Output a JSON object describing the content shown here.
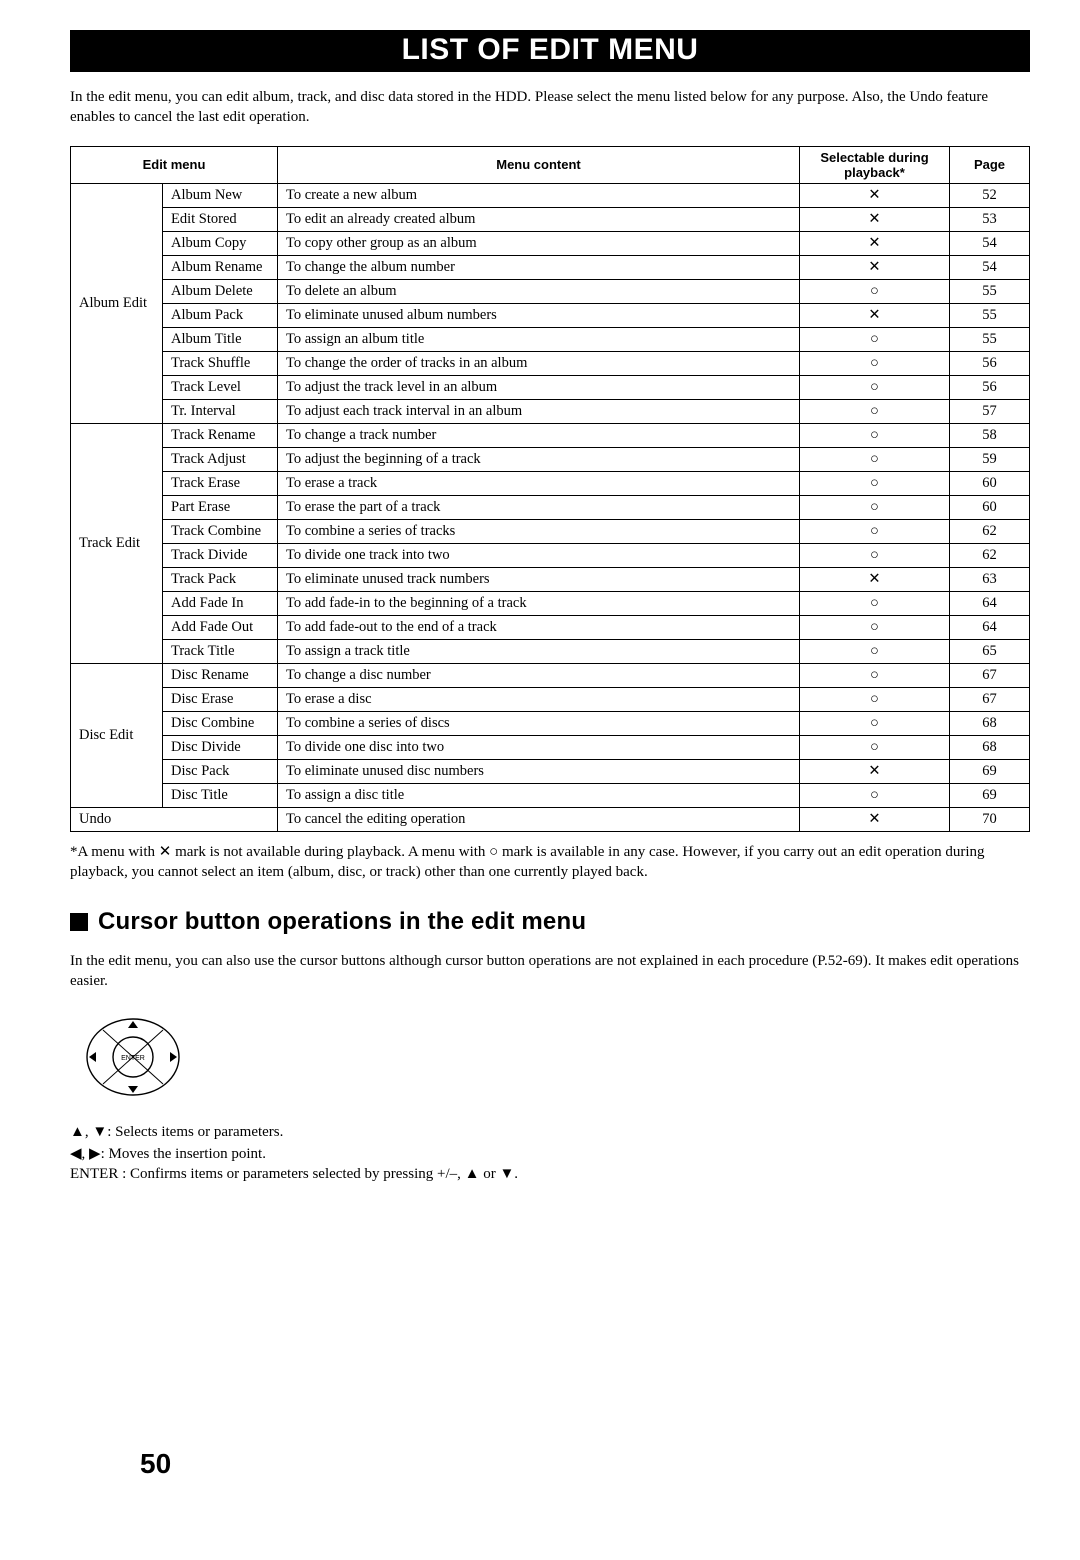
{
  "title": "LIST OF EDIT MENU",
  "intro": "In the edit menu, you can edit album, track, and disc data stored in the HDD. Please select the menu listed below for any purpose. Also, the Undo feature enables to cancel the last edit operation.",
  "headers": {
    "editMenu": "Edit menu",
    "menuContent": "Menu content",
    "selectable": "Selectable during playback*",
    "page": "Page"
  },
  "marks": {
    "x": "✕",
    "o": "○"
  },
  "groups": [
    {
      "name": "Album Edit",
      "rows": [
        {
          "sub": "Album New",
          "content": "To create a new album",
          "sel": "x",
          "page": "52"
        },
        {
          "sub": "Edit Stored",
          "content": "To edit an already created album",
          "sel": "x",
          "page": "53"
        },
        {
          "sub": "Album Copy",
          "content": "To copy other group as an album",
          "sel": "x",
          "page": "54"
        },
        {
          "sub": "Album Rename",
          "content": "To change the album number",
          "sel": "x",
          "page": "54"
        },
        {
          "sub": "Album Delete",
          "content": "To delete an album",
          "sel": "o",
          "page": "55"
        },
        {
          "sub": "Album Pack",
          "content": "To eliminate unused album numbers",
          "sel": "x",
          "page": "55"
        },
        {
          "sub": "Album Title",
          "content": "To assign an album title",
          "sel": "o",
          "page": "55"
        },
        {
          "sub": "Track Shuffle",
          "content": "To change the order of tracks in an album",
          "sel": "o",
          "page": "56"
        },
        {
          "sub": "Track Level",
          "content": "To adjust the track level in an album",
          "sel": "o",
          "page": "56"
        },
        {
          "sub": "Tr. Interval",
          "content": "To adjust each track interval in an album",
          "sel": "o",
          "page": "57"
        }
      ]
    },
    {
      "name": "Track Edit",
      "rows": [
        {
          "sub": "Track Rename",
          "content": "To change a track number",
          "sel": "o",
          "page": "58"
        },
        {
          "sub": "Track Adjust",
          "content": "To adjust the beginning of a track",
          "sel": "o",
          "page": "59"
        },
        {
          "sub": "Track Erase",
          "content": "To erase a track",
          "sel": "o",
          "page": "60"
        },
        {
          "sub": "Part Erase",
          "content": "To erase the part of a track",
          "sel": "o",
          "page": "60"
        },
        {
          "sub": "Track Combine",
          "content": "To combine a series of tracks",
          "sel": "o",
          "page": "62"
        },
        {
          "sub": "Track Divide",
          "content": "To divide one track into two",
          "sel": "o",
          "page": "62"
        },
        {
          "sub": "Track Pack",
          "content": "To eliminate unused track numbers",
          "sel": "x",
          "page": "63"
        },
        {
          "sub": "Add Fade In",
          "content": "To add fade-in to the beginning of a track",
          "sel": "o",
          "page": "64"
        },
        {
          "sub": "Add Fade Out",
          "content": "To add fade-out to the end of a track",
          "sel": "o",
          "page": "64"
        },
        {
          "sub": "Track Title",
          "content": "To assign a track title",
          "sel": "o",
          "page": "65"
        }
      ]
    },
    {
      "name": "Disc Edit",
      "rows": [
        {
          "sub": "Disc Rename",
          "content": "To change a disc number",
          "sel": "o",
          "page": "67"
        },
        {
          "sub": "Disc Erase",
          "content": "To erase a disc",
          "sel": "o",
          "page": "67"
        },
        {
          "sub": "Disc Combine",
          "content": "To combine a series of discs",
          "sel": "o",
          "page": "68"
        },
        {
          "sub": "Disc Divide",
          "content": "To divide one disc into two",
          "sel": "o",
          "page": "68"
        },
        {
          "sub": "Disc Pack",
          "content": "To eliminate unused disc numbers",
          "sel": "x",
          "page": "69"
        },
        {
          "sub": "Disc Title",
          "content": "To assign a disc title",
          "sel": "o",
          "page": "69"
        }
      ]
    }
  ],
  "undo": {
    "name": "Undo",
    "content": "To cancel the editing operation",
    "sel": "x",
    "page": "70"
  },
  "footnote": "*A menu with ✕ mark is not available during playback. A menu with ○ mark is available in any case. However, if you carry out an edit operation during playback, you cannot select an item (album, disc, or track) other than one currently played back.",
  "cursor": {
    "heading": "Cursor button operations in the edit menu",
    "intro": "In the edit menu, you can also use the cursor buttons although cursor button operations are not explained in each procedure (P.52-69). It makes edit operations easier.",
    "legend1": "▲, ▼: Selects items or parameters.",
    "legend2": "◀, ▶: Moves the insertion point.",
    "legend3": "ENTER : Confirms items or parameters selected by pressing +/–, ▲ or ▼.",
    "enterLabel": "ENTER"
  },
  "pageNumber": "50"
}
